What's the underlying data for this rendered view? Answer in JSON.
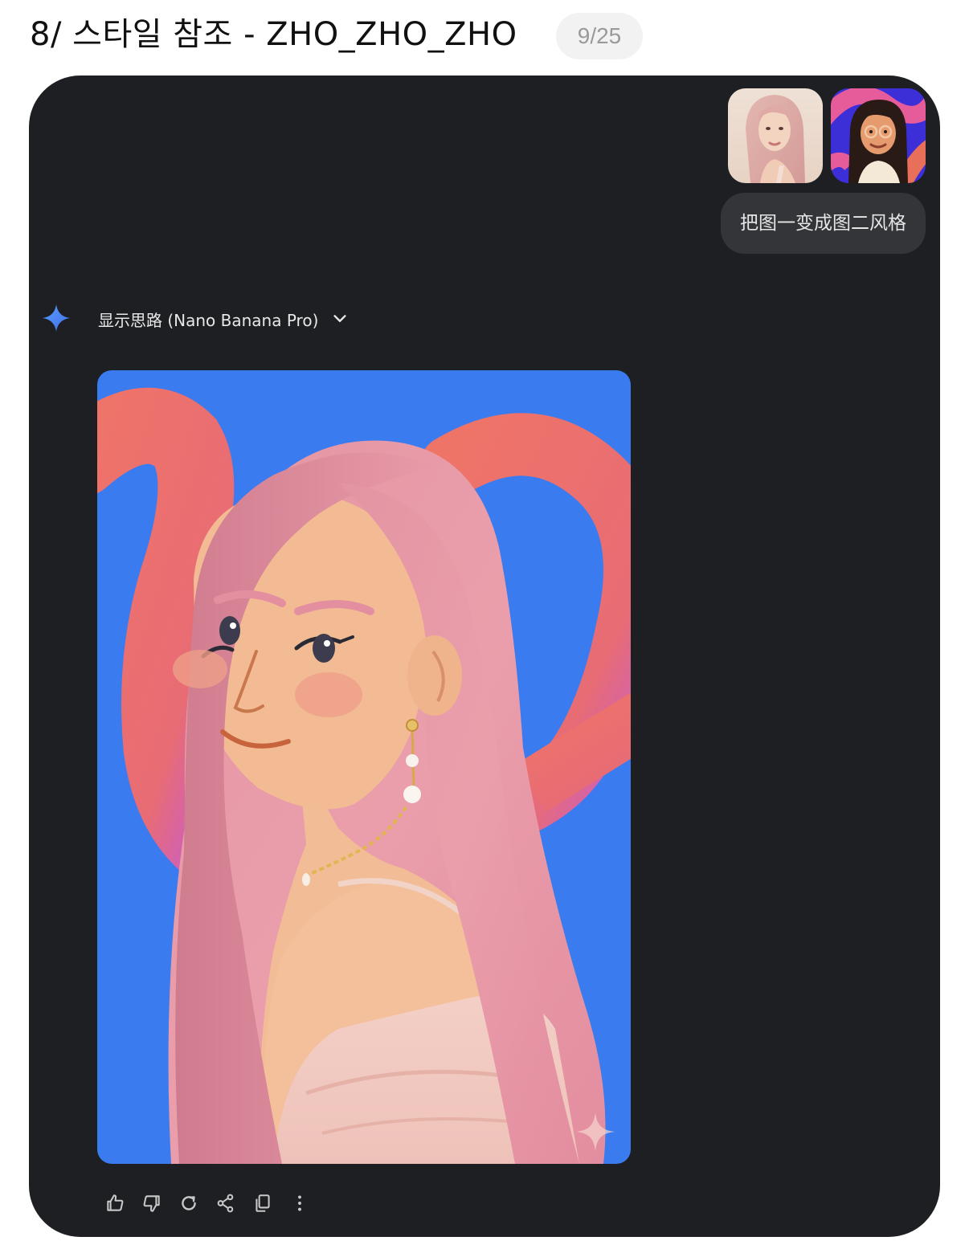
{
  "header": {
    "title": "8/ 스타일 참조 - ZHO_ZHO_ZHO",
    "counter": "9/25"
  },
  "chat": {
    "user_message": {
      "attachments": [
        {
          "name": "photo-portrait-pink-hair"
        },
        {
          "name": "illustration-style-reference"
        }
      ],
      "text": "把图一变成图二风格"
    },
    "response": {
      "thoughts_toggle": "显示思路 (Nano Banana Pro)",
      "image": {
        "name": "generated-illustrated-portrait"
      },
      "actions": [
        {
          "name": "thumbs-up-icon"
        },
        {
          "name": "thumbs-down-icon"
        },
        {
          "name": "regenerate-icon"
        },
        {
          "name": "share-icon"
        },
        {
          "name": "copy-icon"
        },
        {
          "name": "more-vertical-icon"
        }
      ]
    }
  },
  "colors": {
    "card_background": "#1e1f22",
    "bubble_background": "#333539",
    "accent_blue": "#4285f4",
    "image_background": "#3a7bef",
    "swirl_coral": "#ea6e6a",
    "hair_pink": "#e78c9c",
    "skin": "#f2bb94"
  }
}
